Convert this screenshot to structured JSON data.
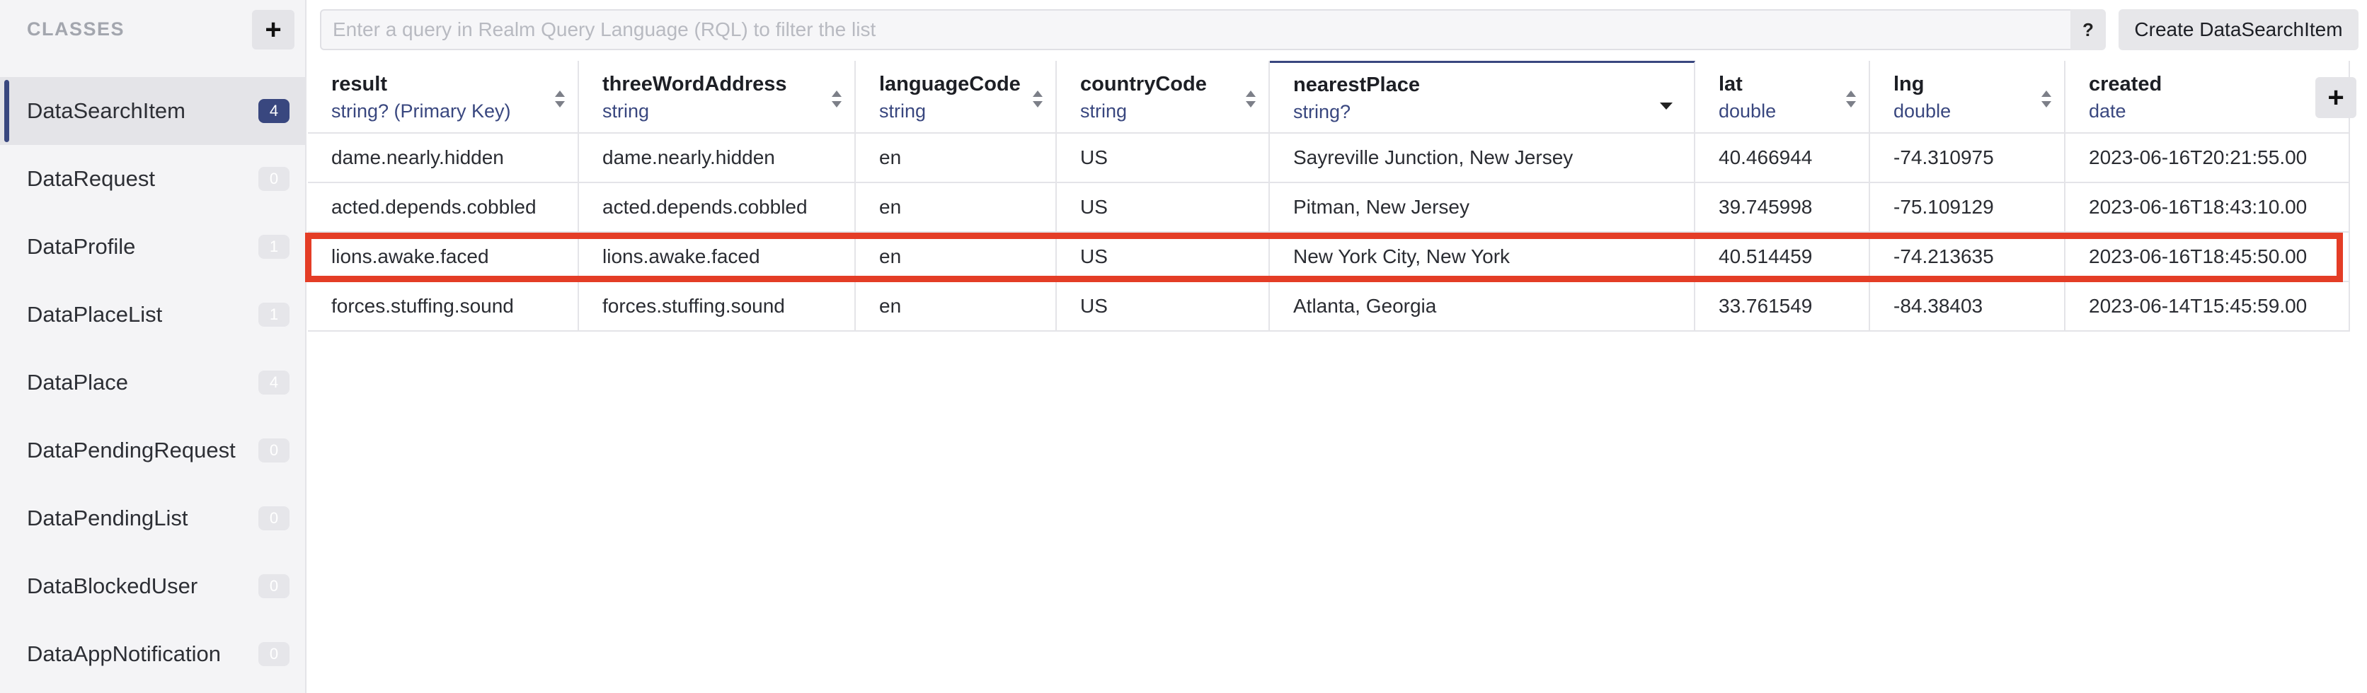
{
  "sidebar": {
    "title": "CLASSES",
    "add_label": "+",
    "items": [
      {
        "name": "DataSearchItem",
        "count": "4"
      },
      {
        "name": "DataRequest",
        "count": "0"
      },
      {
        "name": "DataProfile",
        "count": "1"
      },
      {
        "name": "DataPlaceList",
        "count": "1"
      },
      {
        "name": "DataPlace",
        "count": "4"
      },
      {
        "name": "DataPendingRequest",
        "count": "0"
      },
      {
        "name": "DataPendingList",
        "count": "0"
      },
      {
        "name": "DataBlockedUser",
        "count": "0"
      },
      {
        "name": "DataAppNotification",
        "count": "0"
      }
    ]
  },
  "query": {
    "placeholder": "Enter a query in Realm Query Language (RQL) to filter the list",
    "value": "",
    "help_label": "?",
    "create_label": "Create DataSearchItem"
  },
  "table": {
    "add_column_label": "+",
    "columns": [
      {
        "name": "result",
        "type": "string? (Primary Key)"
      },
      {
        "name": "threeWordAddress",
        "type": "string"
      },
      {
        "name": "languageCode",
        "type": "string"
      },
      {
        "name": "countryCode",
        "type": "string"
      },
      {
        "name": "nearestPlace",
        "type": "string?"
      },
      {
        "name": "lat",
        "type": "double"
      },
      {
        "name": "lng",
        "type": "double"
      },
      {
        "name": "created",
        "type": "date"
      }
    ],
    "rows": [
      [
        "dame.nearly.hidden",
        "dame.nearly.hidden",
        "en",
        "US",
        "Sayreville Junction, New Jersey",
        "40.466944",
        "-74.310975",
        "2023-06-16T20:21:55.00"
      ],
      [
        "acted.depends.cobbled",
        "acted.depends.cobbled",
        "en",
        "US",
        "Pitman, New Jersey",
        "39.745998",
        "-75.109129",
        "2023-06-16T18:43:10.00"
      ],
      [
        "lions.awake.faced",
        "lions.awake.faced",
        "en",
        "US",
        "New York City, New York",
        "40.514459",
        "-74.213635",
        "2023-06-16T18:45:50.00"
      ],
      [
        "forces.stuffing.sound",
        "forces.stuffing.sound",
        "en",
        "US",
        "Atlanta, Georgia",
        "33.761549",
        "-84.38403",
        "2023-06-14T15:45:59.00"
      ]
    ]
  },
  "colors": {
    "accent": "#39477f",
    "highlight": "#e43d26",
    "sidebar_bg": "#f4f4f6"
  }
}
